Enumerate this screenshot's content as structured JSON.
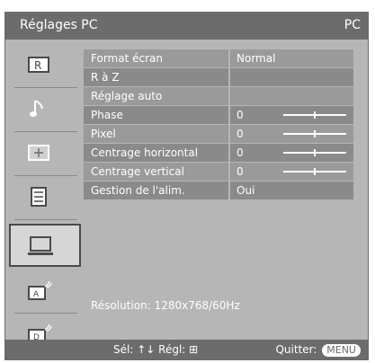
{
  "titlebar": {
    "title": "Réglages PC",
    "source": "PC"
  },
  "sidebar": {
    "items": [
      {
        "icon": "picture-icon"
      },
      {
        "icon": "sound-icon"
      },
      {
        "icon": "screen-icon"
      },
      {
        "icon": "setup-icon"
      },
      {
        "icon": "pc-icon",
        "selected": true
      },
      {
        "icon": "input-a-icon"
      },
      {
        "icon": "input-d-icon"
      }
    ]
  },
  "menu": {
    "rows": [
      {
        "label": "Format écran",
        "value": "Normal"
      },
      {
        "label": "R à Z",
        "value": ""
      },
      {
        "label": "Réglage auto",
        "value": ""
      },
      {
        "label": "Phase",
        "value": "0"
      },
      {
        "label": "Pixel",
        "value": "0"
      },
      {
        "label": "Centrage horizontal",
        "value": "0"
      },
      {
        "label": "Centrage vertical",
        "value": "0"
      },
      {
        "label": "Gestion de l'alim.",
        "value": "Oui"
      }
    ]
  },
  "resolution": "Résolution: 1280x768/60Hz",
  "footer": {
    "select_text": "Sél:",
    "adjust_text": "Régl:",
    "quit_text": "Quitter:",
    "menu_button": "MENU"
  }
}
